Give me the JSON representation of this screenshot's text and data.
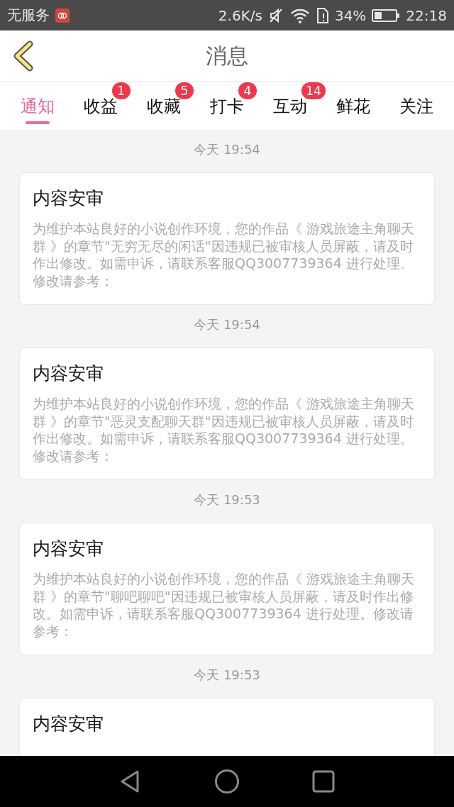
{
  "status_bar": {
    "carrier": "无服务",
    "speed": "2.6K/s",
    "battery": "34%",
    "time": "22:18"
  },
  "header": {
    "title": "消息"
  },
  "tabs": [
    {
      "label": "通知",
      "selected": true
    },
    {
      "label": "收益",
      "selected": false,
      "badge": "1"
    },
    {
      "label": "收藏",
      "selected": false,
      "badge": "5"
    },
    {
      "label": "打卡",
      "selected": false,
      "badge": "4"
    },
    {
      "label": "互动",
      "selected": false,
      "badge": "14"
    },
    {
      "label": "鲜花",
      "selected": false
    },
    {
      "label": "关注",
      "selected": false
    }
  ],
  "messages": [
    {
      "time": "今天 19:54",
      "title": "内容安审",
      "body": "为维护本站良好的小说创作环境，您的作品《 游戏旅途主角聊天群 》的章节\"无穷无尽的闲话\"因违规已被审核人员屏蔽，请及时作出修改。如需申诉，请联系客服QQ3007739364 进行处理。修改请参考："
    },
    {
      "time": "今天 19:54",
      "title": "内容安审",
      "body": "为维护本站良好的小说创作环境，您的作品《 游戏旅途主角聊天群 》的章节\"恶灵支配聊天群\"因违规已被审核人员屏蔽，请及时作出修改。如需申诉，请联系客服QQ3007739364 进行处理。修改请参考："
    },
    {
      "time": "今天 19:53",
      "title": "内容安审",
      "body": "为维护本站良好的小说创作环境，您的作品《 游戏旅途主角聊天群 》的章节\"聊吧聊吧\"因违规已被审核人员屏蔽，请及时作出修改。如需申诉，请联系客服QQ3007739364 进行处理。修改请参考："
    },
    {
      "time": "今天 19:53",
      "title": "内容安审"
    }
  ]
}
